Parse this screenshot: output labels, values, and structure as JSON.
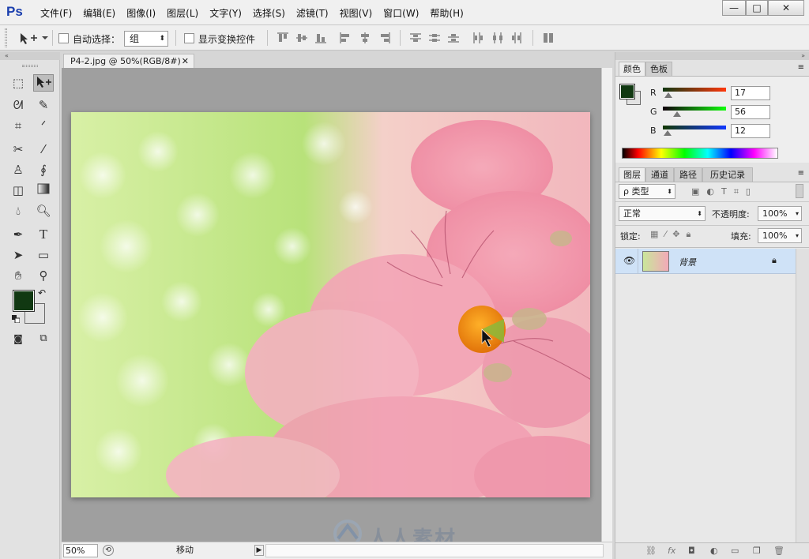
{
  "app": {
    "logo": "Ps"
  },
  "menubar": {
    "items": [
      {
        "label": "文件(F)"
      },
      {
        "label": "编辑(E)"
      },
      {
        "label": "图像(I)"
      },
      {
        "label": "图层(L)"
      },
      {
        "label": "文字(Y)"
      },
      {
        "label": "选择(S)"
      },
      {
        "label": "滤镜(T)"
      },
      {
        "label": "视图(V)"
      },
      {
        "label": "窗口(W)"
      },
      {
        "label": "帮助(H)"
      }
    ],
    "window_buttons": {
      "minimize": "—",
      "maximize": "□",
      "close": "✕"
    }
  },
  "options": {
    "auto_select_label": "自动选择：",
    "auto_select_checked": false,
    "group_value": "组",
    "show_transform_label": "显示变换控件",
    "show_transform_checked": false
  },
  "document": {
    "tab_title": "P4-2.jpg @ 50%(RGB/8#)",
    "zoom": "50%",
    "status_text": "移动"
  },
  "color_panel": {
    "tabs": [
      "颜色",
      "色板"
    ],
    "active_tab": 0,
    "r": {
      "label": "R",
      "value": "17"
    },
    "g": {
      "label": "G",
      "value": "56"
    },
    "b": {
      "label": "B",
      "value": "12"
    },
    "foreground": "#113812",
    "background": "#e2e2e2"
  },
  "layers_panel": {
    "tabs": [
      "图层",
      "通道",
      "路径",
      "历史记录"
    ],
    "active_tab": 0,
    "filter_label": "ρ 类型",
    "blend_mode": "正常",
    "opacity_label": "不透明度:",
    "opacity_value": "100%",
    "lock_label": "锁定:",
    "fill_label": "填充:",
    "fill_value": "100%",
    "layers": [
      {
        "name": "背景",
        "visible": true,
        "locked": true
      }
    ]
  },
  "watermark": {
    "text": "人人素材"
  }
}
